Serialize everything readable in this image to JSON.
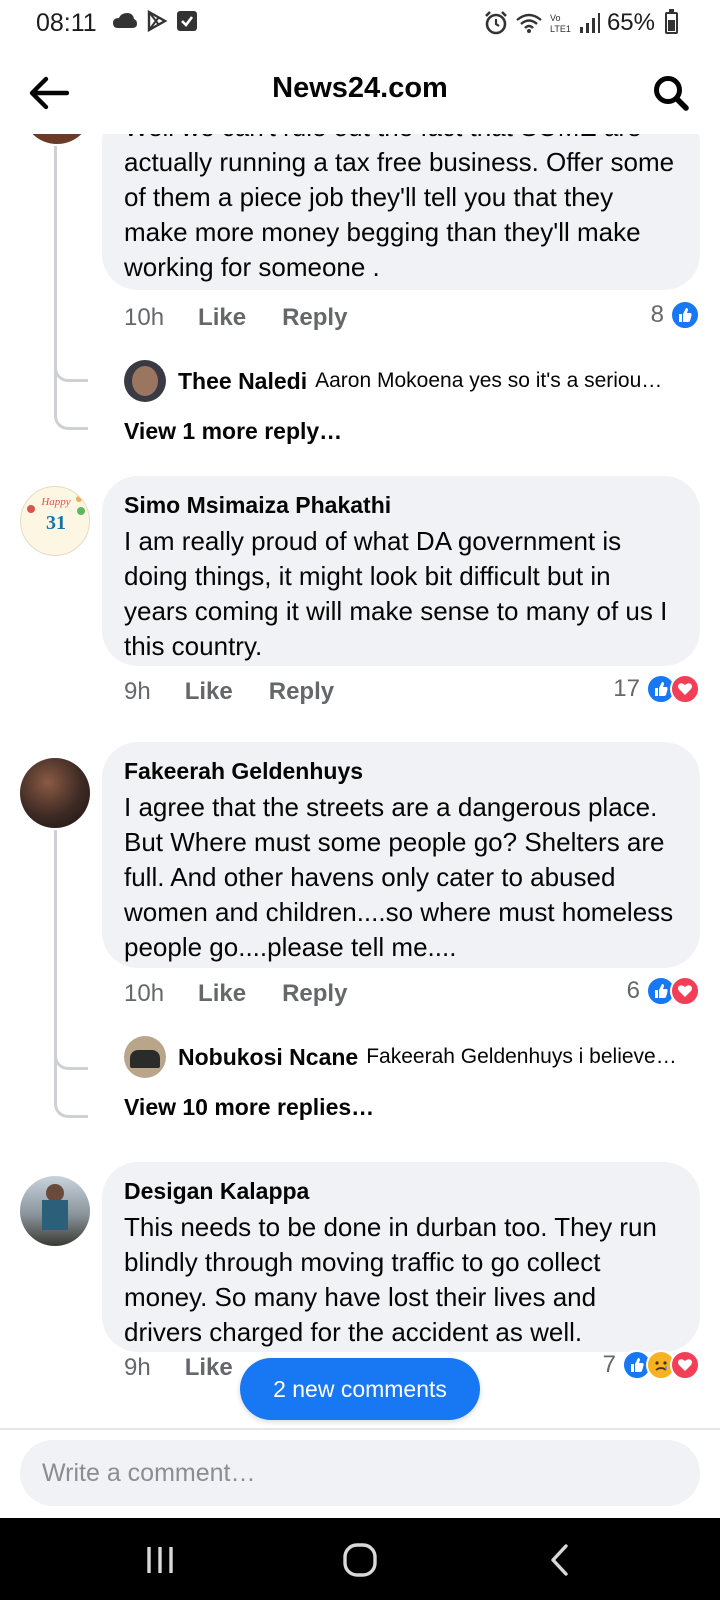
{
  "status_bar": {
    "time": "08:11",
    "battery": "65%",
    "icons": [
      "cloud-icon",
      "play-store-icon",
      "check-box-icon",
      "alarm-icon",
      "wifi-icon",
      "volte-icon",
      "signal-icon",
      "battery-icon"
    ]
  },
  "header": {
    "title": "News24.com",
    "back_icon": "arrow-left-icon",
    "search_icon": "search-icon"
  },
  "comments": [
    {
      "author": "",
      "text": "Well we can't rule out the fact that SOME are actually running a tax free business. Offer some of them a piece job they'll tell you that they make more money begging than they'll make working for someone .",
      "time": "10h",
      "like_label": "Like",
      "reply_label": "Reply",
      "reaction_count": "8",
      "reactions": [
        "like"
      ],
      "reply_preview": {
        "name": "Thee Naledi",
        "text": "Aaron Mokoena yes so it's a seriou…"
      },
      "view_more": "View 1 more reply…"
    },
    {
      "author": "Simo Msimaiza Phakathi",
      "text": "I am really proud of what DA government is doing things, it might look bit difficult but in years coming it will make sense to many of us I this country.",
      "time": "9h",
      "like_label": "Like",
      "reply_label": "Reply",
      "reaction_count": "17",
      "reactions": [
        "like",
        "love"
      ],
      "avatar_text": "31"
    },
    {
      "author": "Fakeerah Geldenhuys",
      "text": "I agree that the streets are a dangerous place. But  Where must some people go? Shelters are full. And other havens only cater to abused women and children....so where must homeless people go....please tell me....",
      "time": "10h",
      "like_label": "Like",
      "reply_label": "Reply",
      "reaction_count": "6",
      "reactions": [
        "like",
        "love"
      ],
      "reply_preview": {
        "name": "Nobukosi Ncane",
        "text": "Fakeerah Geldenhuys i believe…"
      },
      "view_more": "View 10 more replies…"
    },
    {
      "author": "Desigan Kalappa",
      "text": "This needs to be done in durban too. They run blindly through moving traffic to go collect money. So many have lost their lives and drivers charged for the accident as well.",
      "time": "9h",
      "like_label": "Like",
      "reaction_count": "7",
      "reactions": [
        "like",
        "sad",
        "love"
      ]
    }
  ],
  "new_comments_label": "2 new comments",
  "composer_placeholder": "Write a comment…",
  "nav": {
    "recents_icon": "recent-apps-icon",
    "home_icon": "home-icon",
    "back_icon": "back-icon"
  },
  "colors": {
    "accent": "#1877f2",
    "bubble": "#f0f2f5",
    "meta_text": "#65676b",
    "love": "#f33e58",
    "sad": "#f7b125"
  }
}
